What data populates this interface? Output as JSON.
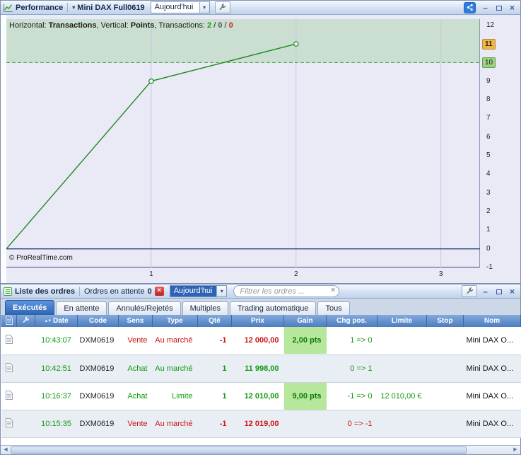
{
  "performance": {
    "titlebar": {
      "title": "Performance",
      "instrument": "Mini DAX Full0619",
      "period": "Aujourd'hui"
    },
    "info_segments": [
      {
        "t": "Horizontal: "
      },
      {
        "t": "Transactions",
        "b": true
      },
      {
        "t": ", Vertical: "
      },
      {
        "t": "Points",
        "b": true
      },
      {
        "t": ", Transactions: "
      },
      {
        "t": "2",
        "b": true,
        "c": "#119911"
      },
      {
        "t": " / "
      },
      {
        "t": "0",
        "b": true,
        "c": "#555555"
      },
      {
        "t": " / "
      },
      {
        "t": "0",
        "b": true,
        "c": "#cc2222"
      }
    ],
    "copyright": "© ProRealTime.com"
  },
  "chart_data": {
    "type": "line",
    "title": "Performance",
    "xlabel": "Transactions",
    "ylabel": "Points",
    "x": [
      0,
      1,
      2
    ],
    "y": [
      0,
      9,
      11
    ],
    "markers": [
      {
        "x": 1,
        "y": 9
      },
      {
        "x": 2,
        "y": 11
      }
    ],
    "x_ticks": [
      1,
      2,
      3
    ],
    "y_ticks": [
      12,
      11,
      10,
      9,
      8,
      7,
      6,
      5,
      4,
      3,
      2,
      1,
      0,
      -1
    ],
    "xlim": [
      0,
      3.27
    ],
    "ylim": [
      -1,
      12.33
    ],
    "highlight_ticks": {
      "11": "current",
      "10": "reference"
    },
    "band": {
      "from": 10,
      "to": 12.33
    },
    "band_color": "rgba(110,190,100,0.25)",
    "dashed_line_y": 10,
    "zero_line_y": 0,
    "series_color": "#1e8a1e",
    "grid": "vertical-only",
    "legend": "none"
  },
  "icons": {
    "performance": "chart-icon",
    "orders": "list-icon",
    "settings": "wrench-icon",
    "share": "share-icon",
    "cancel_pending": "close-icon",
    "sort": "sort-icon",
    "row": "document-icon"
  },
  "orders": {
    "titlebar": {
      "title": "Liste des ordres",
      "pending_label": "Ordres en attente",
      "pending_count": "0",
      "period": "Aujourd'hui",
      "filter_placeholder": "Filtrer les ordres ..."
    },
    "tabs": [
      {
        "label": "Exécutés",
        "active": true
      },
      {
        "label": "En attente",
        "active": false
      },
      {
        "label": "Annulés/Rejetés",
        "active": false
      },
      {
        "label": "Multiples",
        "active": false
      },
      {
        "label": "Trading automatique",
        "active": false
      },
      {
        "label": "Tous",
        "active": false
      }
    ],
    "columns": [
      "Date",
      "Code",
      "Sens",
      "Type",
      "Qté",
      "Prix",
      "Gain",
      "Chg pos.",
      "Limite",
      "Stop",
      "Nom"
    ],
    "rows": [
      {
        "time": "10:43:07",
        "code": "DXM0619",
        "sens": "Vente",
        "type": "Au marché",
        "qty": "-1",
        "price": "12 000,00",
        "gain": "2,00 pts",
        "chg": "1 => 0",
        "limit": "",
        "stop": "",
        "name": "Mini DAX O...",
        "side": "sell",
        "chg_dir": "pos"
      },
      {
        "time": "10:42:51",
        "code": "DXM0619",
        "sens": "Achat",
        "type": "Au marché",
        "qty": "1",
        "price": "11 998,00",
        "gain": "",
        "chg": "0 => 1",
        "limit": "",
        "stop": "",
        "name": "Mini DAX O...",
        "side": "buy",
        "chg_dir": "pos"
      },
      {
        "time": "10:16:37",
        "code": "DXM0619",
        "sens": "Achat",
        "type": "Limite",
        "qty": "1",
        "price": "12 010,00",
        "gain": "9,00 pts",
        "chg": "-1 => 0",
        "limit": "12 010,00 €",
        "stop": "",
        "name": "Mini DAX O...",
        "side": "buy",
        "chg_dir": "pos"
      },
      {
        "time": "10:15:35",
        "code": "DXM0619",
        "sens": "Vente",
        "type": "Au marché",
        "qty": "-1",
        "price": "12 019,00",
        "gain": "",
        "chg": "0 => -1",
        "limit": "",
        "stop": "",
        "name": "Mini DAX O...",
        "side": "sell",
        "chg_dir": "neg"
      }
    ]
  }
}
